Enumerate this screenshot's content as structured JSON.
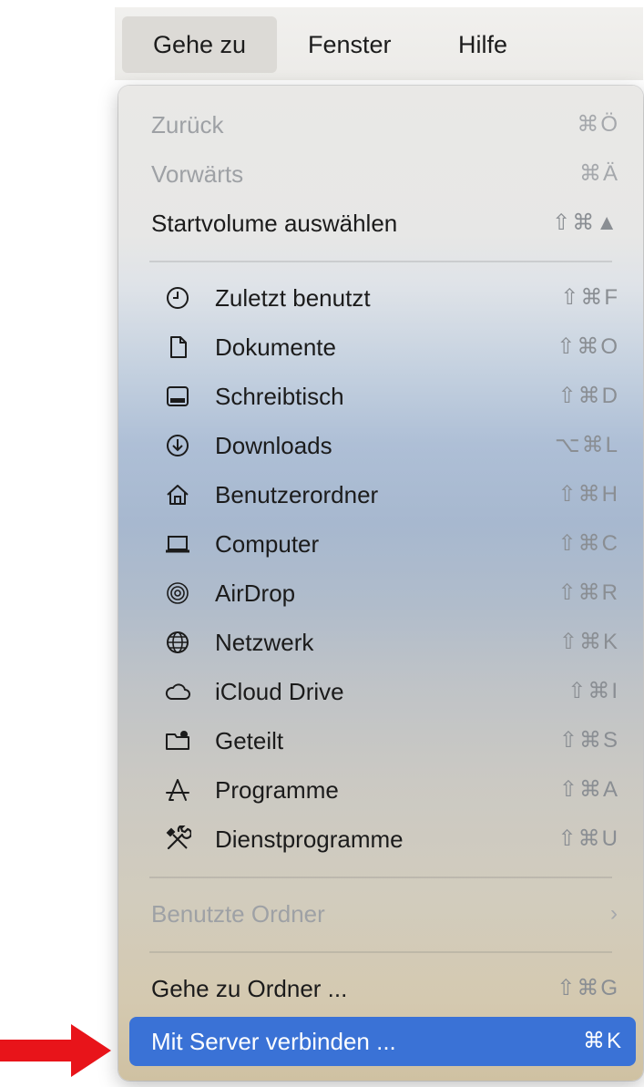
{
  "menubar": {
    "items": [
      {
        "label": "Gehe zu"
      },
      {
        "label": "Fenster"
      },
      {
        "label": "Hilfe"
      }
    ]
  },
  "menu": {
    "items": [
      {
        "label": "Zurück",
        "shortcut": "⌘Ö",
        "icon": null,
        "enabled": false
      },
      {
        "label": "Vorwärts",
        "shortcut": "⌘Ä",
        "icon": null,
        "enabled": false
      },
      {
        "label": "Startvolume auswählen",
        "shortcut": "⇧⌘▲",
        "icon": null,
        "enabled": true
      },
      {
        "label": "Zuletzt benutzt",
        "shortcut": "⇧⌘F",
        "icon": "clock-icon",
        "enabled": true
      },
      {
        "label": "Dokumente",
        "shortcut": "⇧⌘O",
        "icon": "document-icon",
        "enabled": true
      },
      {
        "label": "Schreibtisch",
        "shortcut": "⇧⌘D",
        "icon": "desktop-icon",
        "enabled": true
      },
      {
        "label": "Downloads",
        "shortcut": "⌥⌘L",
        "icon": "download-icon",
        "enabled": true
      },
      {
        "label": "Benutzerordner",
        "shortcut": "⇧⌘H",
        "icon": "home-icon",
        "enabled": true
      },
      {
        "label": "Computer",
        "shortcut": "⇧⌘C",
        "icon": "laptop-icon",
        "enabled": true
      },
      {
        "label": "AirDrop",
        "shortcut": "⇧⌘R",
        "icon": "airdrop-icon",
        "enabled": true
      },
      {
        "label": "Netzwerk",
        "shortcut": "⇧⌘K",
        "icon": "globe-icon",
        "enabled": true
      },
      {
        "label": "iCloud Drive",
        "shortcut": "⇧⌘I",
        "icon": "cloud-icon",
        "enabled": true
      },
      {
        "label": "Geteilt",
        "shortcut": "⇧⌘S",
        "icon": "shared-folder-icon",
        "enabled": true
      },
      {
        "label": "Programme",
        "shortcut": "⇧⌘A",
        "icon": "applications-icon",
        "enabled": true
      },
      {
        "label": "Dienstprogramme",
        "shortcut": "⇧⌘U",
        "icon": "utilities-icon",
        "enabled": true
      },
      {
        "label": "Benutzte Ordner",
        "shortcut": "›",
        "icon": null,
        "enabled": false
      },
      {
        "label": "Gehe zu Ordner ...",
        "shortcut": "⇧⌘G",
        "icon": null,
        "enabled": true
      },
      {
        "label": "Mit Server verbinden ...",
        "shortcut": "⌘K",
        "icon": null,
        "enabled": true,
        "highlighted": true
      }
    ]
  },
  "colors": {
    "highlight": "#3a72d6",
    "arrow": "#e8141a"
  }
}
